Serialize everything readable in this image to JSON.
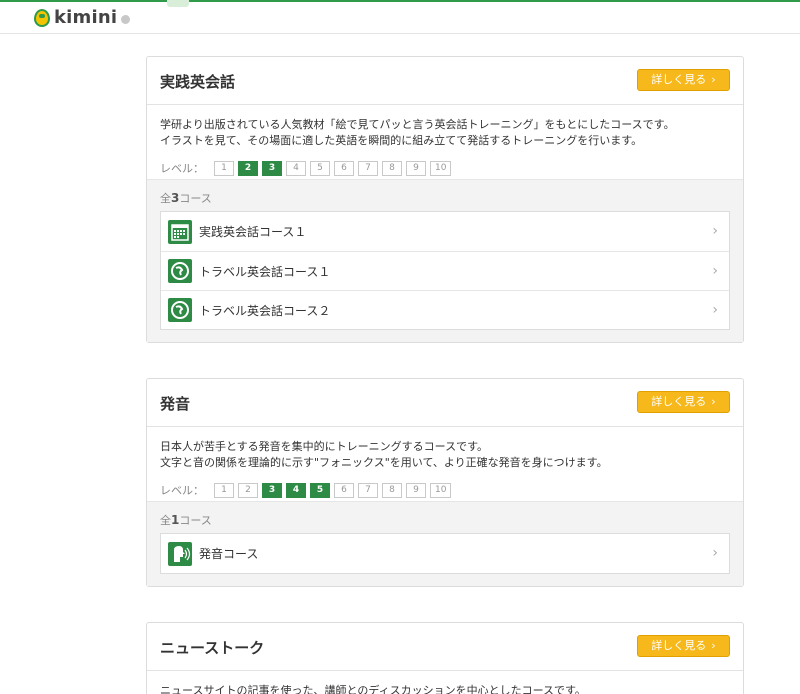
{
  "header": {
    "logo_text": "kimini"
  },
  "cards": [
    {
      "title": "実践英会話",
      "more_label": "詳しく見る",
      "desc1": "学研より出版されている人気教材「絵で見てパッと言う英会話トレーニング」をもとにしたコースです。",
      "desc2": "イラストを見て、その場面に適した英語を瞬間的に組み立てて発話するトレーニングを行います。",
      "level_label": "レベル：",
      "levels": [
        "1",
        "2",
        "3",
        "4",
        "5",
        "6",
        "7",
        "8",
        "9",
        "10"
      ],
      "active_levels": [
        2,
        3
      ],
      "count_prefix": "全",
      "count": "3",
      "count_suffix": "コース",
      "courses": [
        {
          "name": "実践英会話コース１",
          "icon": "calendar-grid-icon"
        },
        {
          "name": "トラベル英会話コース１",
          "icon": "travel-globe-icon"
        },
        {
          "name": "トラベル英会話コース２",
          "icon": "travel-globe-icon"
        }
      ]
    },
    {
      "title": "発音",
      "more_label": "詳しく見る",
      "desc1": "日本人が苦手とする発音を集中的にトレーニングするコースです。",
      "desc2": "文字と音の関係を理論的に示す\"フォニックス\"を用いて、より正確な発音を身につけます。",
      "level_label": "レベル：",
      "levels": [
        "1",
        "2",
        "3",
        "4",
        "5",
        "6",
        "7",
        "8",
        "9",
        "10"
      ],
      "active_levels": [
        3,
        4,
        5
      ],
      "count_prefix": "全",
      "count": "1",
      "count_suffix": "コース",
      "courses": [
        {
          "name": "発音コース",
          "icon": "speaking-head-icon"
        }
      ]
    },
    {
      "title": "ニューストーク",
      "more_label": "詳しく見る",
      "desc1": "ニュースサイトの記事を使った、講師とのディスカッションを中心としたコースです。"
    }
  ],
  "colors": {
    "accent_green": "#2e8b45",
    "button_yellow": "#f6b81a"
  }
}
